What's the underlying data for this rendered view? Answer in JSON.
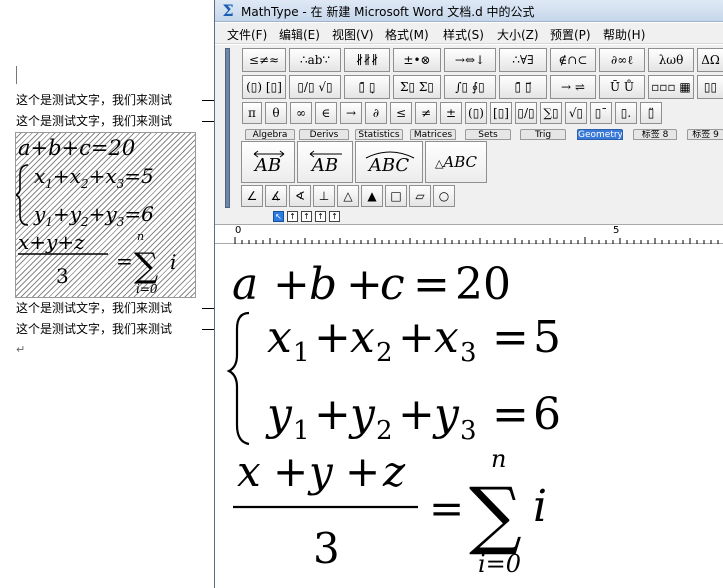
{
  "document": {
    "body_lines": [
      "这个是测试文字，我们来测试",
      "这个是测试文字，我们来测试",
      "这个是测试文字，我们来测试",
      "这个是测试文字，我们来测试"
    ],
    "paragraph_mark": "↵"
  },
  "window": {
    "title": "MathType - 在 新建 Microsoft Word 文档.d 中的公式",
    "app_icon": "Σ"
  },
  "menu": [
    "文件(F)",
    "编辑(E)",
    "视图(V)",
    "格式(M)",
    "样式(S)",
    "大小(Z)",
    "预置(P)",
    "帮助(H)"
  ],
  "toolbar": {
    "row1": [
      "≤≠≈",
      "∴ab∵",
      "∦∦∦",
      "±•⊗",
      "→⇔↓",
      "∴∀∃",
      "∉∩⊂",
      "∂∞ℓ",
      "λωθ",
      "ΔΩ"
    ],
    "row2": [
      "(▯) [▯]",
      "▯/▯ √▯",
      "▯̄ ▯̣",
      "Σ▯ Σ▯",
      "∫▯ ∮▯",
      "▯̄ ▯⃗",
      "→ ⇌",
      "Ū̇ Ů",
      "▫▫▫ ▦",
      "▯▯"
    ],
    "row3": [
      "π",
      "θ",
      "∞",
      "∈",
      "→",
      "∂",
      "≤",
      "≠",
      "±",
      "(▯)",
      "[▯]",
      "▯/▯",
      "∑▯",
      "√▯",
      "▯ˉ",
      "▯.",
      "▯̈"
    ],
    "tabs": [
      "Algebra",
      "Derivs",
      "Statistics",
      "Matrices",
      "Sets",
      "Trig",
      "Geometry",
      "标签 8",
      "标签 9"
    ],
    "active_tab": "Geometry",
    "geometry": [
      "AB",
      "AB",
      "ABC",
      "ABC"
    ],
    "shapes": [
      "∠",
      "∡",
      "∢",
      "⊥",
      "△",
      "▲",
      "□",
      "▱",
      "○"
    ]
  },
  "tab_stops": [
    "↖",
    "↑",
    "↑",
    "↑",
    "↑"
  ],
  "ruler": {
    "marks": [
      "0",
      "5"
    ]
  },
  "equation": {
    "line1": [
      "a",
      "+",
      "b",
      "+",
      "c",
      "=",
      "20"
    ],
    "line2": [
      "x",
      "1",
      "+",
      "x",
      "2",
      "+",
      "x",
      "3",
      "=",
      "5"
    ],
    "line3": [
      "y",
      "1",
      "+",
      "y",
      "2",
      "+",
      "y",
      "3",
      "=",
      "6"
    ],
    "fraction_numerator": [
      "x",
      "+",
      "y",
      "+",
      "z"
    ],
    "fraction_denominator": "3",
    "equals": "=",
    "sum_symbol": "∑",
    "sum_upper": "n",
    "sum_lower": "i=0",
    "sum_body": "i"
  }
}
